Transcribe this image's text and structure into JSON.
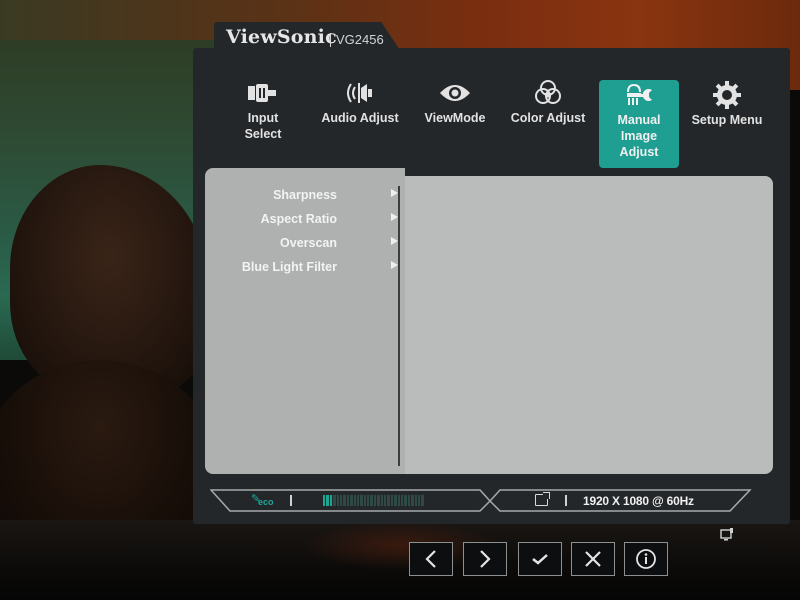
{
  "osd": {
    "brand": "ViewSonic",
    "model": "VG2456",
    "accent_color": "#1f9e92"
  },
  "top_menu": [
    {
      "label_line1": "Input",
      "label_line2": "Select",
      "icon": "input-connector-icon",
      "active": false
    },
    {
      "label_line1": "Audio Adjust",
      "label_line2": "",
      "icon": "speaker-icon",
      "active": false
    },
    {
      "label_line1": "ViewMode",
      "label_line2": "",
      "icon": "eye-icon",
      "active": false
    },
    {
      "label_line1": "Color Adjust",
      "label_line2": "",
      "icon": "color-circles-icon",
      "active": false
    },
    {
      "label_line1": "Manual Image",
      "label_line2": "Adjust",
      "icon": "brush-wrench-icon",
      "active": true
    },
    {
      "label_line1": "Setup Menu",
      "label_line2": "",
      "icon": "gear-icon",
      "active": false
    }
  ],
  "submenu": [
    {
      "label": "Sharpness"
    },
    {
      "label": "Aspect Ratio"
    },
    {
      "label": "Overscan"
    },
    {
      "label": "Blue Light Filter"
    }
  ],
  "status_bar": {
    "eco_label": "eco",
    "eco_level_percent": 10,
    "eco_segments_total": 30,
    "resolution": "1920 X 1080 @ 60Hz"
  },
  "nav_buttons": [
    {
      "name": "previous",
      "icon": "chevron-left-icon"
    },
    {
      "name": "next",
      "icon": "chevron-right-icon"
    },
    {
      "name": "confirm",
      "icon": "check-icon"
    },
    {
      "name": "close",
      "icon": "close-icon"
    },
    {
      "name": "info",
      "icon": "info-icon"
    }
  ]
}
